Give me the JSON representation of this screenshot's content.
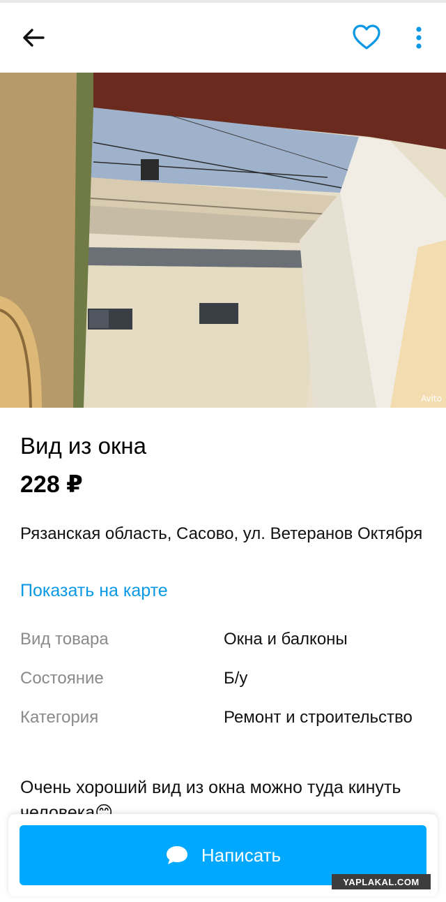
{
  "header": {
    "back_icon": "arrow-left-icon",
    "favorite_icon": "heart-icon",
    "more_icon": "more-vertical-icon"
  },
  "photo": {
    "watermark": "Avito"
  },
  "listing": {
    "title": "Вид из окна",
    "price": "228 ₽",
    "address": "Рязанская область, Сасово, ул. Ветеранов Октября",
    "map_link": "Показать на карте",
    "params": [
      {
        "label": "Вид товара",
        "value": "Окна и балконы"
      },
      {
        "label": "Состояние",
        "value": "Б/у"
      },
      {
        "label": "Категория",
        "value": "Ремонт и строительство"
      }
    ],
    "description": "Очень хороший вид из окна можно туда кинуть человека😊"
  },
  "actions": {
    "write_label": "Написать",
    "write_icon": "chat-bubble-icon"
  },
  "overlay": {
    "site_watermark": "YAPLAKAL.COM"
  },
  "colors": {
    "accent": "#00a9ff",
    "link": "#0a98e5",
    "muted": "#8a8a8a"
  }
}
